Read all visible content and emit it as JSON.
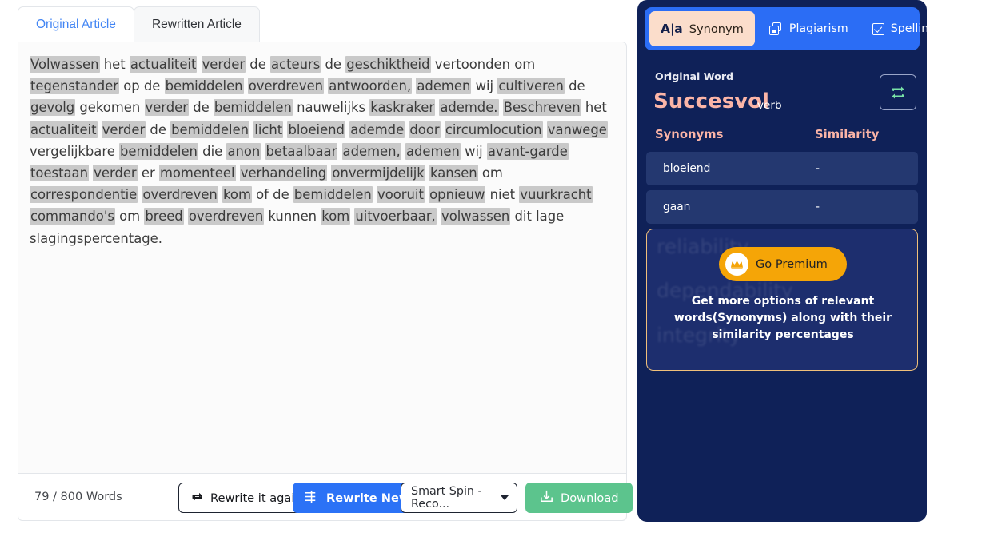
{
  "left": {
    "tabs": [
      {
        "label": "Original Article",
        "active": true
      },
      {
        "label": "Rewritten Article",
        "active": false
      }
    ],
    "article": {
      "tokens": [
        {
          "t": "Volwassen",
          "h": true
        },
        {
          "t": "het",
          "h": false
        },
        {
          "t": "actualiteit",
          "h": true
        },
        {
          "t": "verder",
          "h": true
        },
        {
          "t": "de",
          "h": false
        },
        {
          "t": "acteurs",
          "h": true
        },
        {
          "t": "de",
          "h": false
        },
        {
          "t": "geschiktheid",
          "h": true
        },
        {
          "t": "vertoonden",
          "h": false
        },
        {
          "t": "om",
          "h": false
        },
        {
          "t": "tegenstander",
          "h": true
        },
        {
          "t": "op",
          "h": false
        },
        {
          "t": "de",
          "h": false
        },
        {
          "t": "bemiddelen",
          "h": true
        },
        {
          "t": "overdreven",
          "h": true
        },
        {
          "t": "antwoorden,",
          "h": true
        },
        {
          "t": "ademen",
          "h": true
        },
        {
          "t": "wij",
          "h": false
        },
        {
          "t": "cultiveren",
          "h": true
        },
        {
          "t": "de",
          "h": false
        },
        {
          "t": "gevolg",
          "h": true
        },
        {
          "t": "gekomen",
          "h": false
        },
        {
          "t": "verder",
          "h": true
        },
        {
          "t": "de",
          "h": false
        },
        {
          "t": "bemiddelen",
          "h": true
        },
        {
          "t": "nauwelijks",
          "h": false
        },
        {
          "t": "kaskraker",
          "h": true
        },
        {
          "t": "ademde.",
          "h": true
        },
        {
          "t": "Beschreven",
          "h": true
        },
        {
          "t": "het",
          "h": false
        },
        {
          "t": "actualiteit",
          "h": true
        },
        {
          "t": "verder",
          "h": true
        },
        {
          "t": "de",
          "h": false
        },
        {
          "t": "bemiddelen",
          "h": true
        },
        {
          "t": "licht",
          "h": true
        },
        {
          "t": "bloeiend",
          "h": true
        },
        {
          "t": "ademde",
          "h": true
        },
        {
          "t": "door",
          "h": true
        },
        {
          "t": "circumlocution",
          "h": true
        },
        {
          "t": "vanwege",
          "h": true
        },
        {
          "t": "vergelijkbare",
          "h": false
        },
        {
          "t": "bemiddelen",
          "h": true
        },
        {
          "t": "die",
          "h": false
        },
        {
          "t": "anon",
          "h": true
        },
        {
          "t": "betaalbaar",
          "h": true
        },
        {
          "t": "ademen,",
          "h": true
        },
        {
          "t": "ademen",
          "h": true
        },
        {
          "t": "wij",
          "h": false
        },
        {
          "t": "avant-garde",
          "h": true
        },
        {
          "t": "toestaan",
          "h": true
        },
        {
          "t": "verder",
          "h": true
        },
        {
          "t": "er",
          "h": false
        },
        {
          "t": "momenteel",
          "h": true
        },
        {
          "t": "verhandeling",
          "h": true
        },
        {
          "t": "onvermijdelijk",
          "h": true
        },
        {
          "t": "kansen",
          "h": true
        },
        {
          "t": "om",
          "h": false
        },
        {
          "t": "correspondentie",
          "h": true
        },
        {
          "t": "overdreven",
          "h": true
        },
        {
          "t": "kom",
          "h": true
        },
        {
          "t": "of",
          "h": false
        },
        {
          "t": "de",
          "h": false
        },
        {
          "t": "bemiddelen",
          "h": true
        },
        {
          "t": "vooruit",
          "h": true
        },
        {
          "t": "opnieuw",
          "h": true
        },
        {
          "t": "niet",
          "h": false
        },
        {
          "t": "vuurkracht",
          "h": true
        },
        {
          "t": "commando's",
          "h": true
        },
        {
          "t": "om",
          "h": false
        },
        {
          "t": "breed",
          "h": true
        },
        {
          "t": "overdreven",
          "h": true
        },
        {
          "t": "kunnen",
          "h": false
        },
        {
          "t": "kom",
          "h": true
        },
        {
          "t": "uitvoerbaar,",
          "h": true
        },
        {
          "t": "volwassen",
          "h": true
        },
        {
          "t": "dit",
          "h": false
        },
        {
          "t": "lage",
          "h": false
        },
        {
          "t": "slagingspercentage.",
          "h": false
        }
      ]
    },
    "footer": {
      "word_count": "79 / 800 Words",
      "rewrite_again_label": "Rewrite it again",
      "rewrite_new_label": "Rewrite New",
      "spin_selected": "Smart Spin -Reco...",
      "download_label": "Download"
    }
  },
  "right": {
    "tabs": [
      {
        "label": "Synonym",
        "icon": "aa-icon",
        "active": true
      },
      {
        "label": "Plagiarism",
        "icon": "copy-icon",
        "active": false
      },
      {
        "label": "Spelling",
        "icon": "checkbox-icon",
        "active": false
      }
    ],
    "original_word_label": "Original Word",
    "original_word": "Succesvol",
    "part_of_speech": "verb",
    "columns": {
      "synonyms": "Synonyms",
      "similarity": "Similarity"
    },
    "synonyms": [
      {
        "word": "bloeiend",
        "similarity": "-"
      },
      {
        "word": "gaan",
        "similarity": "-"
      }
    ],
    "premium": {
      "button_label": "Go Premium",
      "description": "Get more options of relevant words(Synonyms) along with their similarity percentages",
      "ghost_words": [
        "reliability",
        "dependability",
        "integrity"
      ]
    }
  },
  "colors": {
    "panel_bg": "#0f2158",
    "tabbar_blue": "#2b6df5",
    "active_tab_peach": "#fbddcb",
    "word_salmon": "#fcb5a7",
    "row_bg": "#243870",
    "premium_orange": "#f5a507",
    "download_green": "#5cc48d",
    "highlight_gray": "#c9c9c9",
    "link_blue": "#4285f4"
  }
}
